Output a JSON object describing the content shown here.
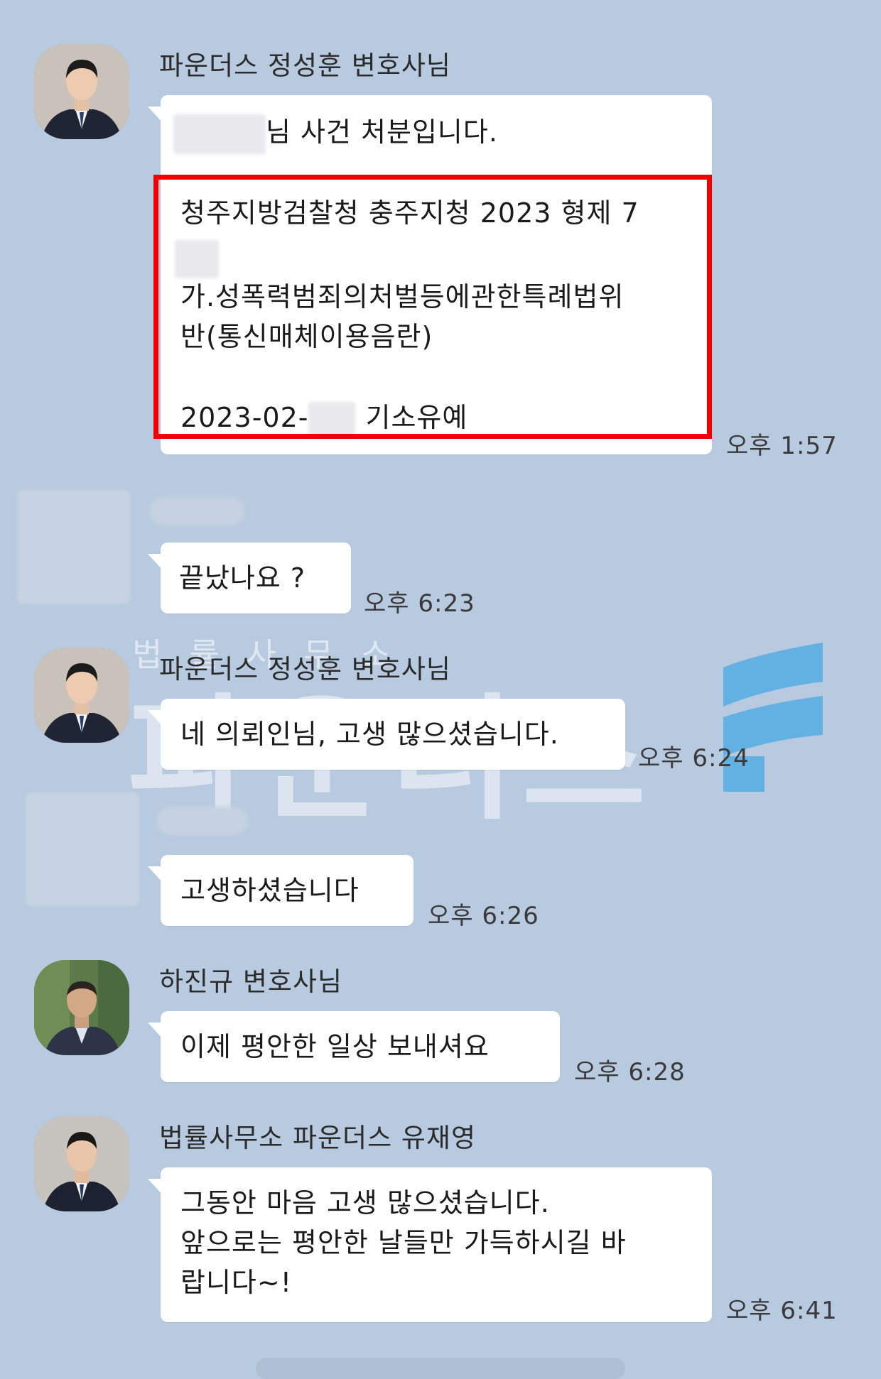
{
  "chat": {
    "messages": [
      {
        "sender": "파운더스 정성훈 변호사님",
        "intro_suffix": "님 사건 처분입니다.",
        "case_line1": "청주지방검찰청 충주지청 2023 형제 7",
        "case_line2": "가.성폭력범죄의처벌등에관한특례법위",
        "case_line3": "반(통신매체이용음란)",
        "date_prefix": "2023-02-",
        "disposition": "기소유예",
        "time": "오후 1:57"
      },
      {
        "sender": "",
        "text": "끝났나요 ?",
        "time": "오후 6:23"
      },
      {
        "sender": "파운더스 정성훈 변호사님",
        "text": "네 의뢰인님, 고생 많으셨습니다.",
        "time": "오후 6:24"
      },
      {
        "sender": "",
        "text": "고생하셨습니다",
        "time": "오후 6:26"
      },
      {
        "sender": "하진규 변호사님",
        "text": "이제 평안한 일상 보내셔요",
        "time": "오후 6:28"
      },
      {
        "sender": "법률사무소 파운더스 유재영",
        "text_line1": "그동안 마음 고생 많으셨습니다.",
        "text_line2": "앞으로는 평안한 날들만 가득하시길 바",
        "text_line3": "랍니다~!",
        "time": "오후 6:41"
      }
    ]
  },
  "watermark": {
    "small": "법률사무소",
    "big": "파운더스",
    "accent_color": "#3aa6e8"
  },
  "colors": {
    "background": "#b8cadf",
    "bubble": "#ffffff",
    "highlight_box": "#f00000"
  },
  "icons": {
    "avatar": "profile-photo"
  }
}
